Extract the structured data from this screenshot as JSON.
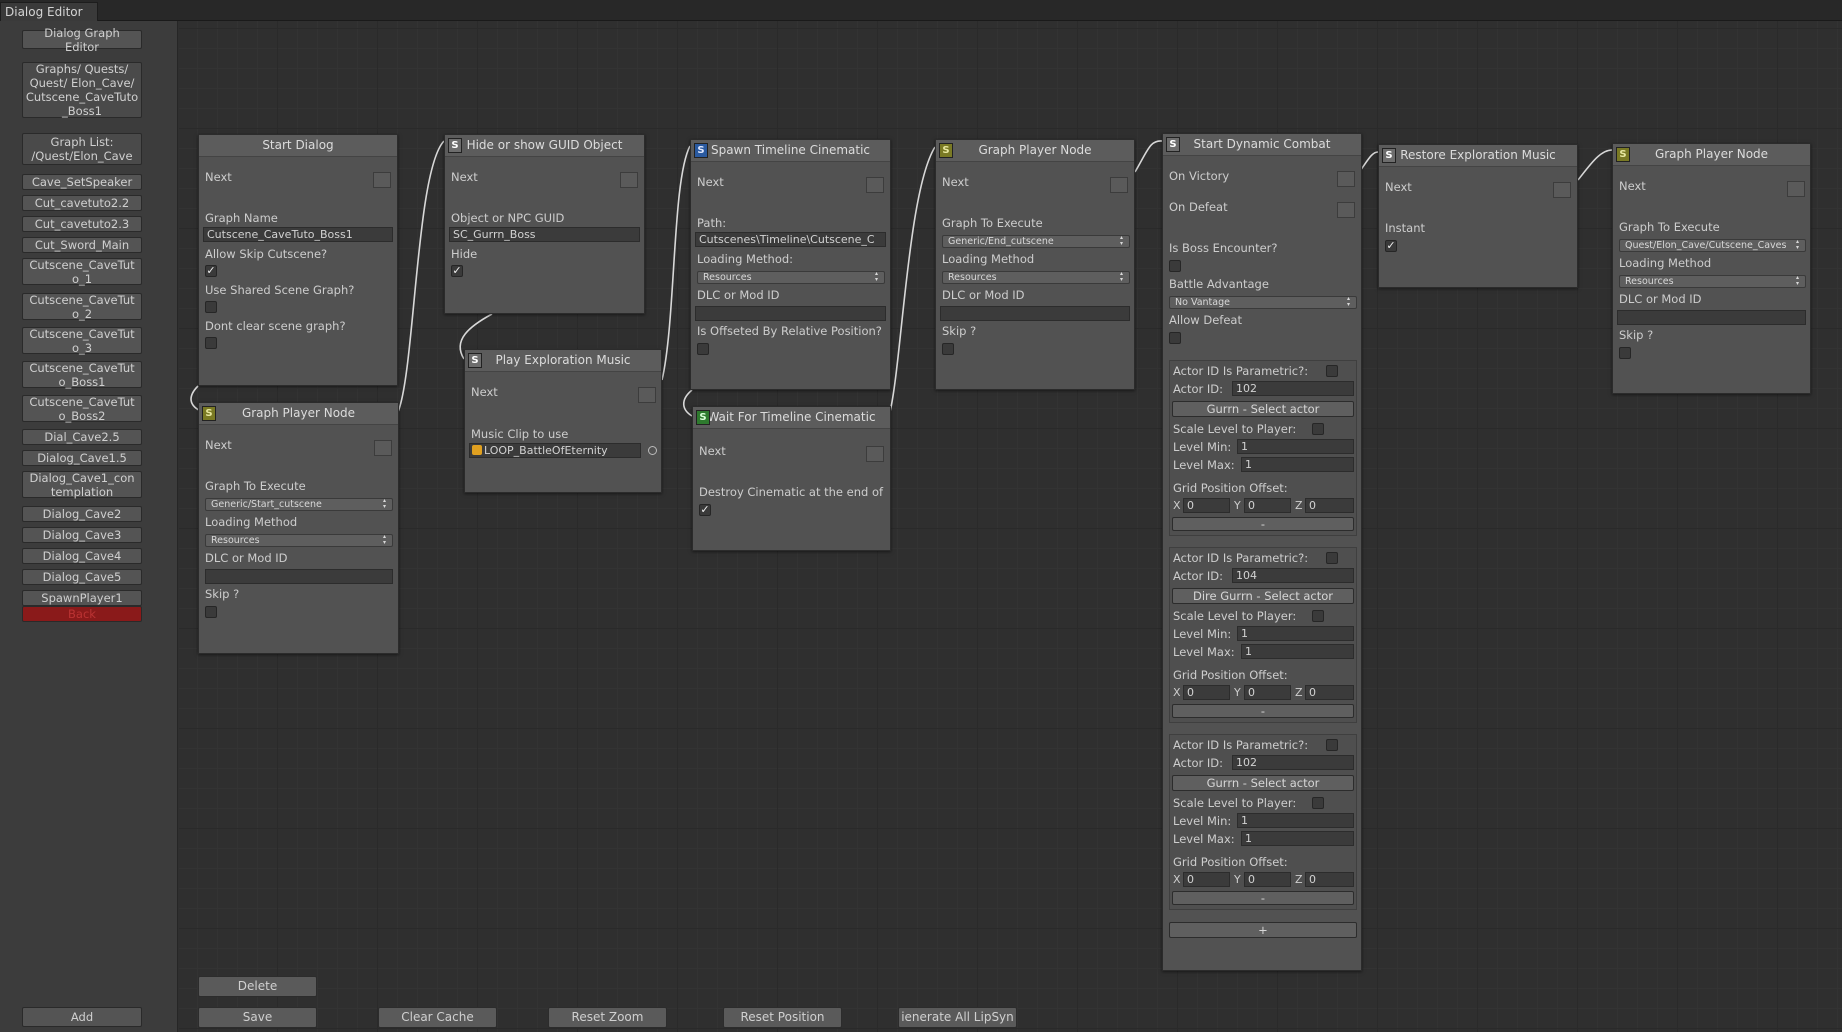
{
  "window": {
    "tab": "Dialog Editor"
  },
  "sidebar": {
    "header_button": "Dialog Graph Editor",
    "path": "Graphs/ Quests/ Quest/ Elon_Cave/ Cutscene_CaveTuto _Boss1",
    "graph_list": "Graph List: /Quest/Elon_Cave",
    "items": [
      "Cave_SetSpeaker",
      "Cut_cavetuto2.2",
      "Cut_cavetuto2.3",
      "Cut_Sword_Main",
      "Cutscene_CaveTut o_1",
      "Cutscene_CaveTut o_2",
      "Cutscene_CaveTut o_3",
      "Cutscene_CaveTut o_Boss1",
      "Cutscene_CaveTut o_Boss2",
      "Dial_Cave2.5",
      "Dialog_Cave1.5",
      "Dialog_Cave1_con templation",
      "Dialog_Cave2",
      "Dialog_Cave3",
      "Dialog_Cave4",
      "Dialog_Cave5",
      "SpawnPlayer1"
    ],
    "back": "Back",
    "add": "Add",
    "back_color": "#8a1a1a"
  },
  "nodes": {
    "start_dialog": {
      "title": "Start Dialog",
      "next": "Next",
      "graph_name_label": "Graph Name",
      "graph_name": "Cutscene_CaveTuto_Boss1",
      "allow_skip": "Allow Skip Cutscene?",
      "use_shared": "Use Shared Scene Graph?",
      "dont_clear": "Dont clear scene graph?"
    },
    "graph_player_1": {
      "icon": "S",
      "title": "Graph Player Node",
      "next": "Next",
      "graph_label": "Graph To Execute",
      "graph": "Generic/Start_cutscene",
      "loading_label": "Loading Method",
      "loading": "Resources",
      "dlc_label": "DLC or Mod ID",
      "skip": "Skip ?"
    },
    "hide_guid": {
      "icon": "S",
      "title": "Hide or show GUID Object",
      "next": "Next",
      "guid_label": "Object or NPC GUID",
      "guid": "SC_Gurrn_Boss",
      "hide": "Hide"
    },
    "play_music": {
      "icon": "S",
      "title": "Play Exploration Music",
      "next": "Next",
      "clip_label": "Music Clip to use",
      "clip": "LOOP_BattleOfEternity"
    },
    "spawn_timeline": {
      "icon": "S",
      "title": "Spawn Timeline Cinematic",
      "next": "Next",
      "path_label": "Path:",
      "path": "Cutscenes\\Timeline\\Cutscene_C",
      "loading_label": "Loading Method:",
      "loading": "Resources",
      "dlc_label": "DLC or Mod ID",
      "offset_label": "Is Offseted By Relative Position?"
    },
    "wait_timeline": {
      "icon": "S",
      "title": "Wait For Timeline Cinematic",
      "next": "Next",
      "destroy_label": "Destroy Cinematic at the end of"
    },
    "graph_player_2": {
      "icon": "S",
      "title": "Graph Player Node",
      "next": "Next",
      "graph_label": "Graph To Execute",
      "graph": "Generic/End_cutscene",
      "loading_label": "Loading Method",
      "loading": "Resources",
      "dlc_label": "DLC or Mod ID",
      "skip": "Skip ?"
    },
    "combat": {
      "icon": "S",
      "title": "Start Dynamic Combat",
      "on_victory": "On Victory",
      "on_defeat": "On Defeat",
      "boss_label": "Is Boss Encounter?",
      "advantage_label": "Battle Advantage",
      "advantage": "No Vantage",
      "allow_defeat": "Allow Defeat",
      "add": "+",
      "actors": [
        {
          "param": "Actor ID Is Parametric?:",
          "id_label": "Actor ID:",
          "id": "102",
          "select": "Gurrn - Select actor",
          "scale": "Scale Level to Player:",
          "min_label": "Level Min:",
          "min": "1",
          "max_label": "Level Max:",
          "max": "1",
          "grid_label": "Grid Position Offset:",
          "x": "0",
          "y": "0",
          "z": "0",
          "remove": "-"
        },
        {
          "param": "Actor ID Is Parametric?:",
          "id_label": "Actor ID:",
          "id": "104",
          "select": "Dire Gurrn - Select actor",
          "scale": "Scale Level to Player:",
          "min_label": "Level Min:",
          "min": "1",
          "max_label": "Level Max:",
          "max": "1",
          "grid_label": "Grid Position Offset:",
          "x": "0",
          "y": "0",
          "z": "0",
          "remove": "-"
        },
        {
          "param": "Actor ID Is Parametric?:",
          "id_label": "Actor ID:",
          "id": "102",
          "select": "Gurrn - Select actor",
          "scale": "Scale Level to Player:",
          "min_label": "Level Min:",
          "min": "1",
          "max_label": "Level Max:",
          "max": "1",
          "grid_label": "Grid Position Offset:",
          "x": "0",
          "y": "0",
          "z": "0",
          "remove": "-"
        }
      ]
    },
    "restore_music": {
      "icon": "S",
      "title": "Restore Exploration Music",
      "next": "Next",
      "instant": "Instant"
    },
    "graph_player_3": {
      "icon": "S",
      "title": "Graph Player Node",
      "next": "Next",
      "graph_label": "Graph To Execute",
      "graph": "Quest/Elon_Cave/Cutscene_Caves",
      "loading_label": "Loading Method",
      "loading": "Resources",
      "dlc_label": "DLC or Mod ID",
      "skip": "Skip ?"
    }
  },
  "axis": {
    "x": "X",
    "y": "Y",
    "z": "Z"
  },
  "toolbar": {
    "delete": "Delete",
    "save": "Save",
    "clear_cache": "Clear Cache",
    "reset_zoom": "Reset Zoom",
    "reset_position": "Reset Position",
    "generate_lipsync": "ienerate All LipSyn"
  }
}
